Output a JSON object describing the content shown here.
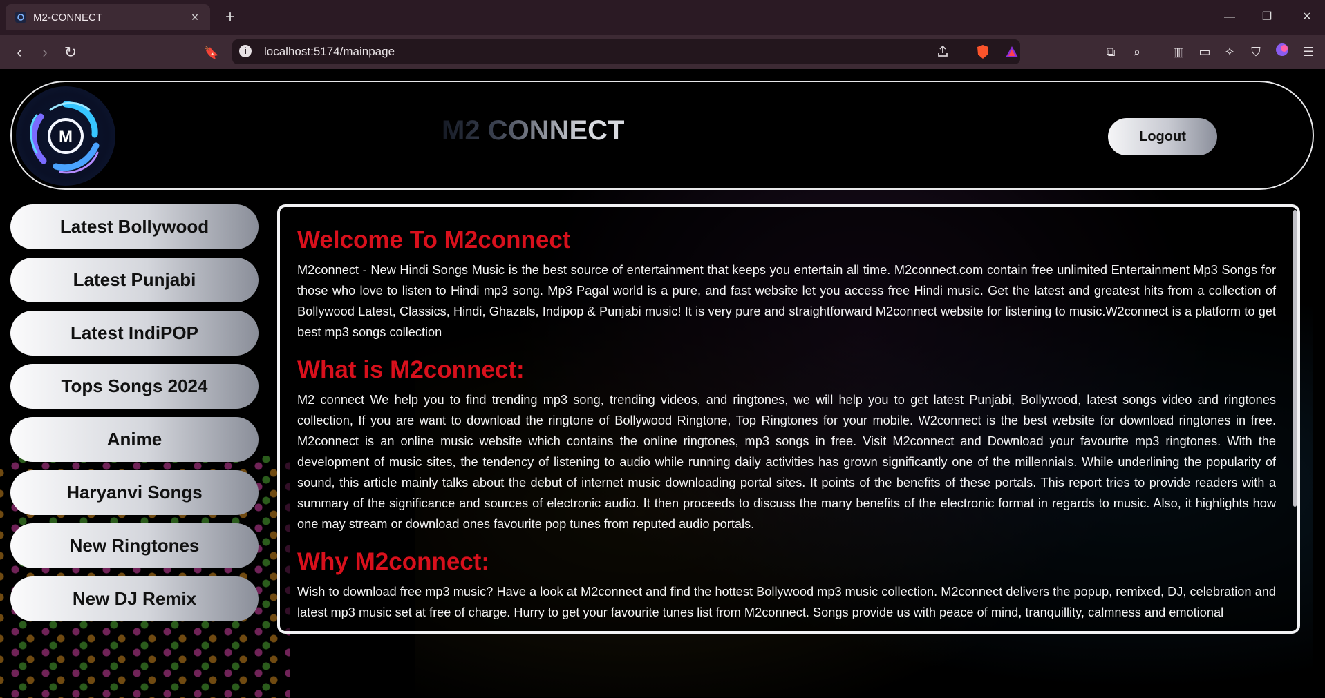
{
  "browser": {
    "tab_title": "M2-CONNECT",
    "url": "localhost:5174/mainpage"
  },
  "header": {
    "logo_letter": "M",
    "brand": "M2 CONNECT",
    "logout_label": "Logout"
  },
  "sidebar": {
    "items": [
      {
        "label": "Latest Bollywood"
      },
      {
        "label": "Latest Punjabi"
      },
      {
        "label": "Latest IndiPOP"
      },
      {
        "label": "Tops Songs 2024"
      },
      {
        "label": "Anime"
      },
      {
        "label": "Haryanvi Songs"
      },
      {
        "label": "New Ringtones"
      },
      {
        "label": "New DJ Remix"
      }
    ]
  },
  "content": {
    "sections": [
      {
        "heading": "Welcome To M2connect",
        "body": "M2connect - New Hindi Songs Music is the best source of entertainment that keeps you entertain all time. M2connect.com contain free unlimited Entertainment Mp3 Songs for those who love to listen to Hindi mp3 song. Mp3 Pagal world is a pure, and fast website let you access free Hindi music. Get the latest and greatest hits from a collection of Bollywood Latest, Classics, Hindi, Ghazals, Indipop & Punjabi music! It is very pure and straightforward M2connect website for listening to music.W2connect is a platform to get best mp3 songs collection"
      },
      {
        "heading": "What is M2connect:",
        "body": "M2 connect We help you to find trending mp3 song, trending videos, and ringtones, we will help you to get latest Punjabi, Bollywood, latest songs video and ringtones collection, If you are want to download the ringtone of Bollywood Ringtone, Top Ringtones for your mobile. W2connect is the best website for download ringtones in free. M2connect is an online music website which contains the online ringtones, mp3 songs in free. Visit M2connect and Download your favourite mp3 ringtones. With the development of music sites, the tendency of listening to audio while running daily activities has grown significantly one of the millennials. While underlining the popularity of sound, this article mainly talks about the debut of internet music downloading portal sites. It points of the benefits of these portals. This report tries to provide readers with a summary of the significance and sources of electronic audio. It then proceeds to discuss the many benefits of the electronic format in regards to music. Also, it highlights how one may stream or download ones favourite pop tunes from reputed audio portals."
      },
      {
        "heading": "Why M2connect:",
        "body": "Wish to download free mp3 music? Have a look at M2connect and find the hottest Bollywood mp3 music collection. M2connect delivers the popup, remixed, DJ, celebration and latest mp3 music set at free of charge. Hurry to get your favourite tunes list from M2connect. Songs provide us with peace of mind, tranquillity, calmness and emotional"
      }
    ]
  }
}
